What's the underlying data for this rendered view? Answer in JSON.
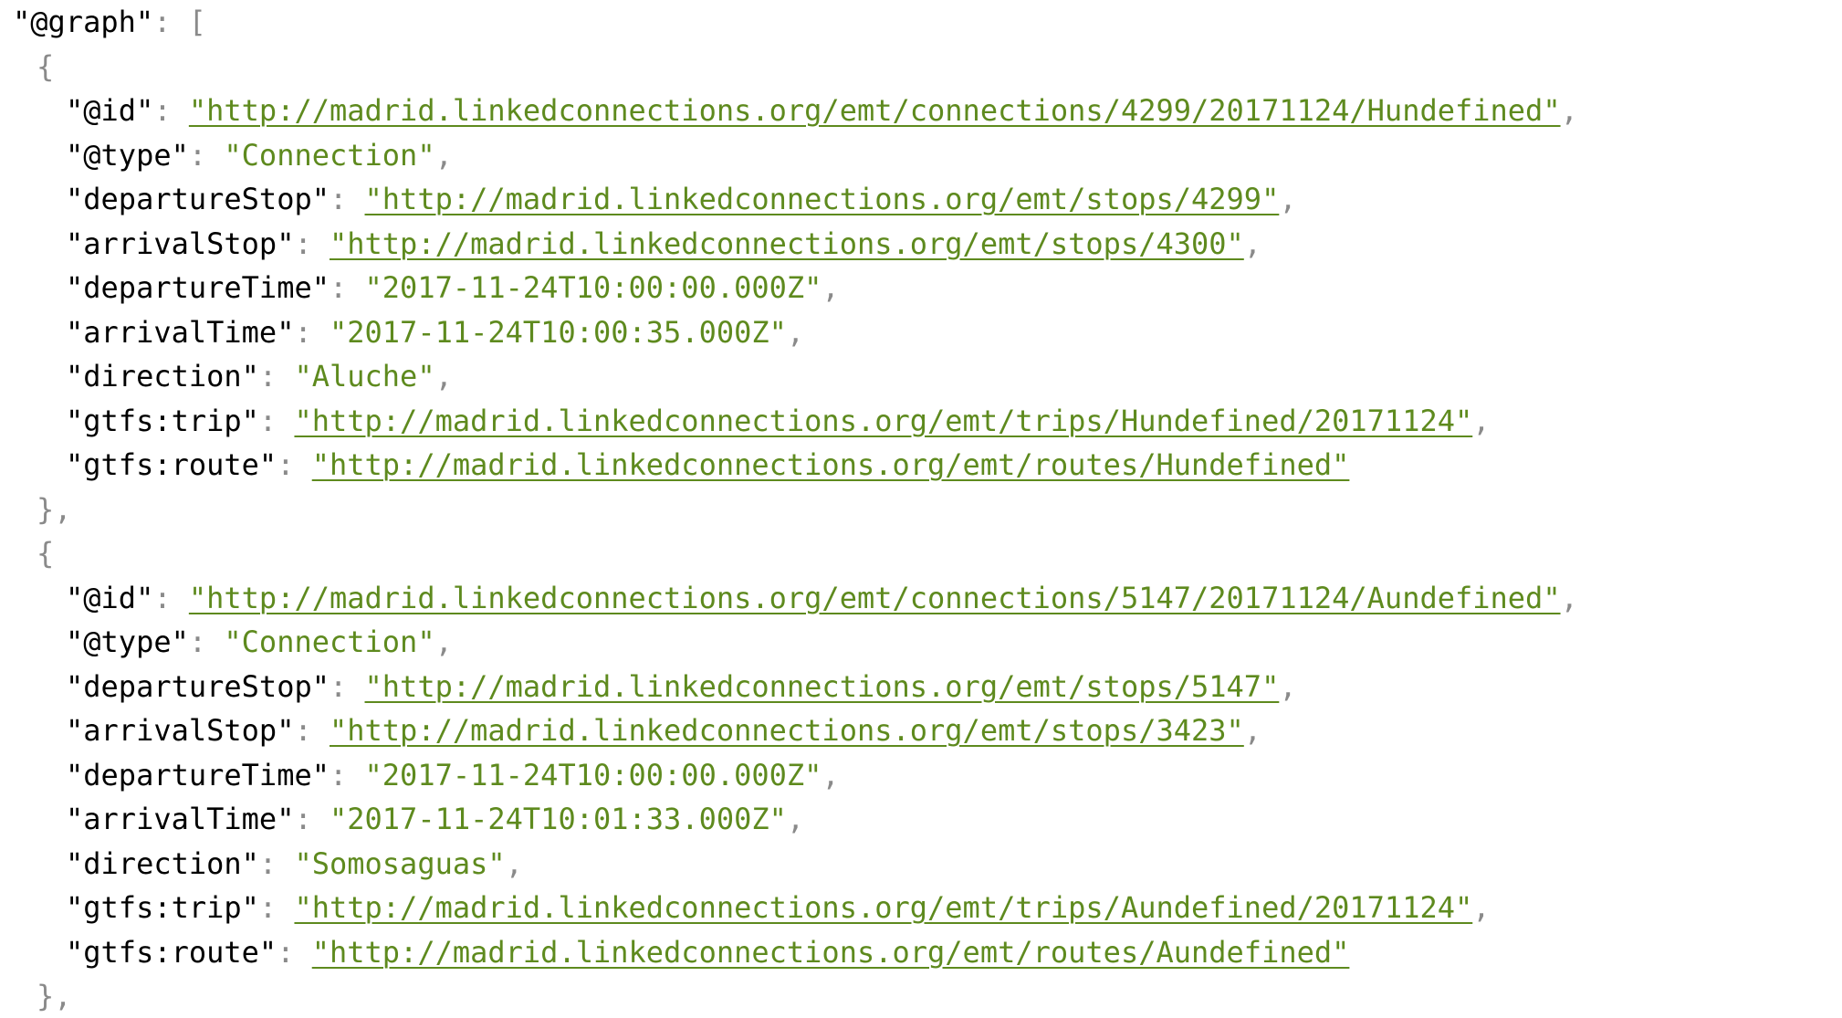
{
  "graph": {
    "key": "\"@graph\"",
    "objects": [
      {
        "fields": [
          {
            "key": "\"@id\"",
            "value": "\"http://madrid.linkedconnections.org/emt/connections/4299/20171124/Hundefined\"",
            "is_link": true,
            "trailing_comma": true
          },
          {
            "key": "\"@type\"",
            "value": "\"Connection\"",
            "is_link": false,
            "trailing_comma": true
          },
          {
            "key": "\"departureStop\"",
            "value": "\"http://madrid.linkedconnections.org/emt/stops/4299\"",
            "is_link": true,
            "trailing_comma": true
          },
          {
            "key": "\"arrivalStop\"",
            "value": "\"http://madrid.linkedconnections.org/emt/stops/4300\"",
            "is_link": true,
            "trailing_comma": true
          },
          {
            "key": "\"departureTime\"",
            "value": "\"2017-11-24T10:00:00.000Z\"",
            "is_link": false,
            "trailing_comma": true
          },
          {
            "key": "\"arrivalTime\"",
            "value": "\"2017-11-24T10:00:35.000Z\"",
            "is_link": false,
            "trailing_comma": true
          },
          {
            "key": "\"direction\"",
            "value": "\"Aluche\"",
            "is_link": false,
            "trailing_comma": true
          },
          {
            "key": "\"gtfs:trip\"",
            "value": "\"http://madrid.linkedconnections.org/emt/trips/Hundefined/20171124\"",
            "is_link": true,
            "trailing_comma": true
          },
          {
            "key": "\"gtfs:route\"",
            "value": "\"http://madrid.linkedconnections.org/emt/routes/Hundefined\"",
            "is_link": true,
            "trailing_comma": false
          }
        ]
      },
      {
        "fields": [
          {
            "key": "\"@id\"",
            "value": "\"http://madrid.linkedconnections.org/emt/connections/5147/20171124/Aundefined\"",
            "is_link": true,
            "trailing_comma": true
          },
          {
            "key": "\"@type\"",
            "value": "\"Connection\"",
            "is_link": false,
            "trailing_comma": true
          },
          {
            "key": "\"departureStop\"",
            "value": "\"http://madrid.linkedconnections.org/emt/stops/5147\"",
            "is_link": true,
            "trailing_comma": true
          },
          {
            "key": "\"arrivalStop\"",
            "value": "\"http://madrid.linkedconnections.org/emt/stops/3423\"",
            "is_link": true,
            "trailing_comma": true
          },
          {
            "key": "\"departureTime\"",
            "value": "\"2017-11-24T10:00:00.000Z\"",
            "is_link": false,
            "trailing_comma": true
          },
          {
            "key": "\"arrivalTime\"",
            "value": "\"2017-11-24T10:01:33.000Z\"",
            "is_link": false,
            "trailing_comma": true
          },
          {
            "key": "\"direction\"",
            "value": "\"Somosaguas\"",
            "is_link": false,
            "trailing_comma": true
          },
          {
            "key": "\"gtfs:trip\"",
            "value": "\"http://madrid.linkedconnections.org/emt/trips/Aundefined/20171124\"",
            "is_link": true,
            "trailing_comma": true
          },
          {
            "key": "\"gtfs:route\"",
            "value": "\"http://madrid.linkedconnections.org/emt/routes/Aundefined\"",
            "is_link": true,
            "trailing_comma": false
          }
        ]
      }
    ]
  },
  "colors": {
    "key": "#000000",
    "punctuation": "#8a8a8a",
    "string": "#5e8a1e",
    "background": "#ffffff"
  }
}
